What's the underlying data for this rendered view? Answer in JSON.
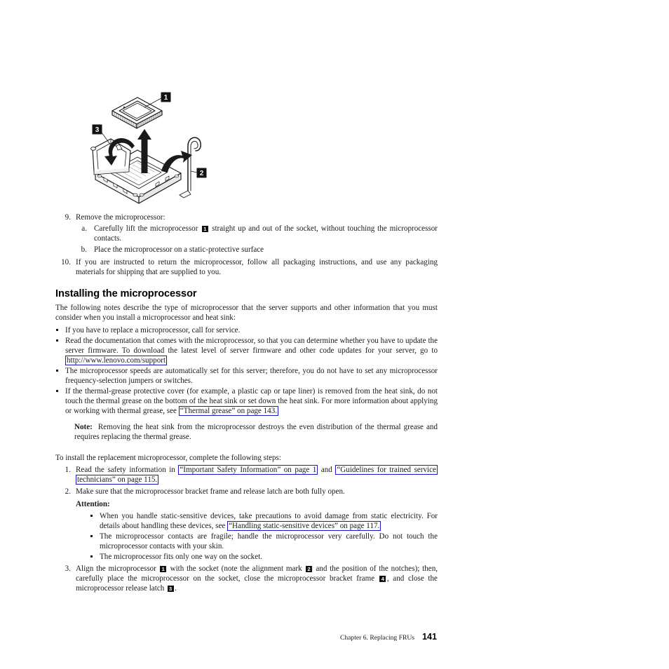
{
  "document": {
    "page_number": "141",
    "footer_chapter": "Chapter 6. Replacing FRUs"
  },
  "figure": {
    "name": "microprocessor-socket-removal-diagram",
    "callouts": [
      {
        "id": "1",
        "label": "1",
        "meaning": "microprocessor"
      },
      {
        "id": "2",
        "label": "2",
        "meaning": "microprocessor release latch"
      },
      {
        "id": "3",
        "label": "3",
        "meaning": "microprocessor bracket frame"
      }
    ]
  },
  "steps_removal": {
    "step9": {
      "marker": "9.",
      "text": "Remove the microprocessor:",
      "substeps": [
        {
          "marker": "a.",
          "text_before": "Carefully lift the microprocessor",
          "chip": "1",
          "text_after": "straight up and out of the socket, without touching the microprocessor contacts."
        },
        {
          "marker": "b.",
          "text": "Place the microprocessor on a static-protective surface"
        }
      ]
    },
    "step10": {
      "marker": "10.",
      "text": "If you are instructed to return the microprocessor, follow all packaging instructions, and use any packaging materials for shipping that are supplied to you."
    }
  },
  "section": {
    "heading": "Installing the microprocessor",
    "intro": "The following notes describe the type of microprocessor that the server supports and other information that you must consider when you install a microprocessor and heat sink:",
    "notes": [
      {
        "text": "If you have to replace a microprocessor, call for service."
      },
      {
        "text_before": "Read the documentation that comes with the microprocessor, so that you can determine whether you have to update the server firmware. To download the latest level of server firmware and other code updates for your server, go to",
        "link": "http://www.lenovo.com/support",
        "text_after": ""
      },
      {
        "text": "The microprocessor speeds are automatically set for this server; therefore, you do not have to set any microprocessor frequency-selection jumpers or switches."
      },
      {
        "text_before": "If the thermal-grease protective cover (for example, a plastic cap or tape liner) is removed from the heat sink, do not touch the thermal grease on the bottom of the heat sink or set down the heat sink. For more information about applying or working with thermal grease, see",
        "link": "“Thermal grease” on page 143.",
        "text_after": ""
      }
    ],
    "note_block": {
      "label": "Note:",
      "text": "Removing the heat sink from the microprocessor destroys the even distribution of the thermal grease and requires replacing the thermal grease."
    }
  },
  "install": {
    "lead_in": "To install the replacement microprocessor, complete the following steps:",
    "steps": [
      {
        "marker": "1.",
        "text_before": "Read the safety information in",
        "link1": "“Important Safety Information” on page 1",
        "text_middle": "and",
        "link2": "“Guidelines for trained service technicians” on page 115.",
        "text_after": ""
      },
      {
        "marker": "2.",
        "text": "Make sure that the microprocessor bracket frame and release latch are both fully open."
      }
    ],
    "attention": {
      "label": "Attention:",
      "items": [
        {
          "text_before": "When you handle static-sensitive devices, take precautions to avoid damage from static electricity. For details about handling these devices, see",
          "link": "“Handling static-sensitive devices” on page 117.",
          "text_after": ""
        },
        {
          "text": "The microprocessor contacts are fragile; handle the microprocessor very carefully. Do not touch the microprocessor contacts with your skin."
        },
        {
          "text": "The microprocessor fits only one way on the socket."
        }
      ]
    },
    "step3": {
      "marker": "3.",
      "t1": "Align the microprocessor",
      "c1": "1",
      "t2": "with the socket (note the alignment mark",
      "c2": "2",
      "t3": "and the position of the notches); then, carefully place the microprocessor on the socket, close the microprocessor bracket frame",
      "c3": "4",
      "t4": ", and close the microprocessor release latch",
      "c4": "3",
      "t5": "."
    }
  },
  "colors": {
    "link_border": "#1818c8",
    "text": "#1a1a1a",
    "chip_bg": "#111111"
  }
}
